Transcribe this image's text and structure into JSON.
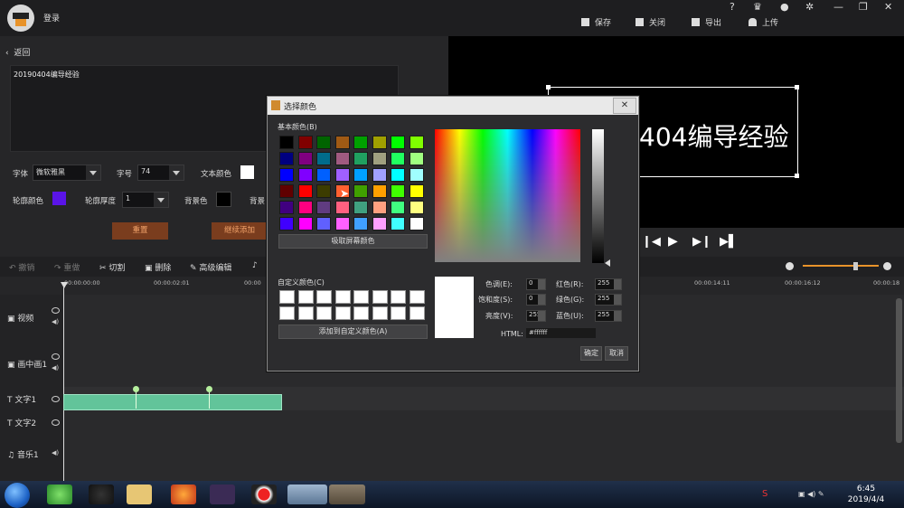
{
  "app": {
    "login": "登录"
  },
  "topbar": {
    "save": "保存",
    "close": "关闭",
    "export": "导出",
    "upload": "上传",
    "help": "?"
  },
  "left": {
    "back": "返回",
    "text": "20190404编导经验",
    "font_label": "字体",
    "font_value": "微软雅黑",
    "size_label": "字号",
    "size_value": "74",
    "text_color_label": "文本颜色",
    "text_color": "#ffffff",
    "outline_color_label": "轮廓颜色",
    "outline_color": "#5a14e8",
    "outline_width_label": "轮廓厚度",
    "outline_width_value": "1",
    "bg_color_label": "背景色",
    "bg_color": "#000000",
    "bg_label2": "背景",
    "reset": "重置",
    "add_more": "继续添加"
  },
  "preview": {
    "text": "404编导经验"
  },
  "toolbar": {
    "undo": "撤销",
    "redo": "重做",
    "cut": "切割",
    "delete": "删除",
    "advanced": "高级编辑"
  },
  "ruler": [
    "00:00:00:00",
    "00:00:02:01",
    "00:00",
    "00:00:14:11",
    "00:00:16:12",
    "00:00:18"
  ],
  "tracks": [
    "视频",
    "画中画1",
    "文字1",
    "文字2",
    "音乐1"
  ],
  "taskbar": {
    "time": "6:45",
    "date": "2019/4/4"
  },
  "dialog": {
    "title": "选择颜色",
    "basic_label": "基本颜色(B)",
    "pick_screen": "吸取屏幕颜色",
    "custom_label": "自定义颜色(C)",
    "add_custom": "添加到自定义颜色(A)",
    "hue_label": "色调(E):",
    "hue": "0",
    "sat_label": "饱和度(S):",
    "sat": "0",
    "lum_label": "亮度(V):",
    "lum": "255",
    "red_label": "红色(R):",
    "red": "255",
    "green_label": "绿色(G):",
    "green": "255",
    "blue_label": "蓝色(U):",
    "blue": "255",
    "html_label": "HTML:",
    "html": "#ffffff",
    "ok": "确定",
    "cancel": "取消",
    "basic_colors": [
      "#000000",
      "#800000",
      "#006400",
      "#a05a14",
      "#00a000",
      "#a0a000",
      "#00ff00",
      "#80ff00",
      "#000080",
      "#800080",
      "#006c8c",
      "#a05a80",
      "#20a060",
      "#a0a080",
      "#20ff60",
      "#a0ff80",
      "#0000ff",
      "#8000ff",
      "#0060ff",
      "#a060ff",
      "#00a0ff",
      "#a0a0ff",
      "#00ffff",
      "#a0ffff",
      "#600000",
      "#ff0000",
      "#3c3c00",
      "#ff6030",
      "#40a000",
      "#ffa000",
      "#40ff00",
      "#ffff00",
      "#400080",
      "#ff0080",
      "#603c80",
      "#ff6080",
      "#40a080",
      "#ffa080",
      "#40ff80",
      "#ffff80",
      "#4000ff",
      "#ff00ff",
      "#6060ff",
      "#ff60ff",
      "#40a0ff",
      "#ffa0ff",
      "#40ffff",
      "#ffffff"
    ]
  }
}
